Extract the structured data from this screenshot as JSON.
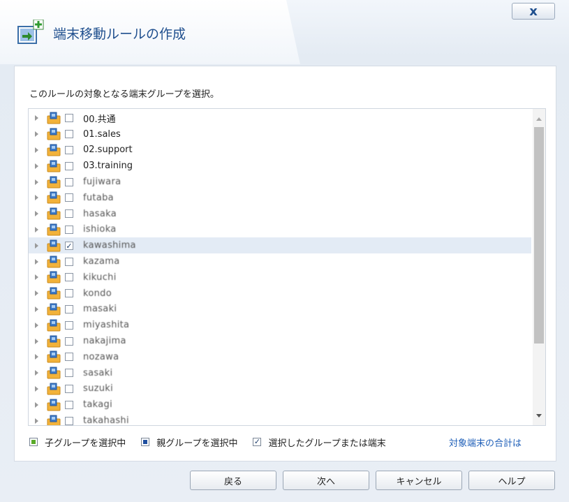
{
  "dialog": {
    "title": "端末移動ルールの作成",
    "close_label": "x"
  },
  "instruction": "このルールの対象となる端末グループを選択。",
  "tree": {
    "items": [
      {
        "label": "00.共通",
        "checked": false,
        "selected": false,
        "blur": false
      },
      {
        "label": "01.sales",
        "checked": false,
        "selected": false,
        "blur": false
      },
      {
        "label": "02.support",
        "checked": false,
        "selected": false,
        "blur": false
      },
      {
        "label": "03.training",
        "checked": false,
        "selected": false,
        "blur": false
      },
      {
        "label": "fujiwara",
        "checked": false,
        "selected": false,
        "blur": true
      },
      {
        "label": "futaba",
        "checked": false,
        "selected": false,
        "blur": true
      },
      {
        "label": "hasaka",
        "checked": false,
        "selected": false,
        "blur": true
      },
      {
        "label": "ishioka",
        "checked": false,
        "selected": false,
        "blur": true
      },
      {
        "label": "kawashima",
        "checked": true,
        "selected": true,
        "blur": true
      },
      {
        "label": "kazama",
        "checked": false,
        "selected": false,
        "blur": true
      },
      {
        "label": "kikuchi",
        "checked": false,
        "selected": false,
        "blur": true
      },
      {
        "label": "kondo",
        "checked": false,
        "selected": false,
        "blur": true
      },
      {
        "label": "masaki",
        "checked": false,
        "selected": false,
        "blur": true
      },
      {
        "label": "miyashita",
        "checked": false,
        "selected": false,
        "blur": true
      },
      {
        "label": "nakajima",
        "checked": false,
        "selected": false,
        "blur": true
      },
      {
        "label": "nozawa",
        "checked": false,
        "selected": false,
        "blur": true
      },
      {
        "label": "sasaki",
        "checked": false,
        "selected": false,
        "blur": true
      },
      {
        "label": "suzuki",
        "checked": false,
        "selected": false,
        "blur": true
      },
      {
        "label": "takagi",
        "checked": false,
        "selected": false,
        "blur": true
      },
      {
        "label": "takahashi",
        "checked": false,
        "selected": false,
        "blur": true
      }
    ]
  },
  "legend": {
    "child_selected": "子グループを選択中",
    "parent_selected": "親グループを選択中",
    "selected": "選択したグループまたは端末",
    "total_link": "対象端末の合計は"
  },
  "buttons": {
    "back": "戻る",
    "next": "次へ",
    "cancel": "キャンセル",
    "help": "ヘルプ"
  },
  "colors": {
    "accent": "#1f4f8e",
    "child_swatch": "#5aaa2a",
    "parent_swatch": "#1f4fa0",
    "selected_row": "#e3ebf5",
    "link": "#1f5fb8"
  },
  "icons": {
    "title": "rule-create-icon",
    "tree_item": "group-folder-icon",
    "expander": "expand-arrow-icon"
  }
}
